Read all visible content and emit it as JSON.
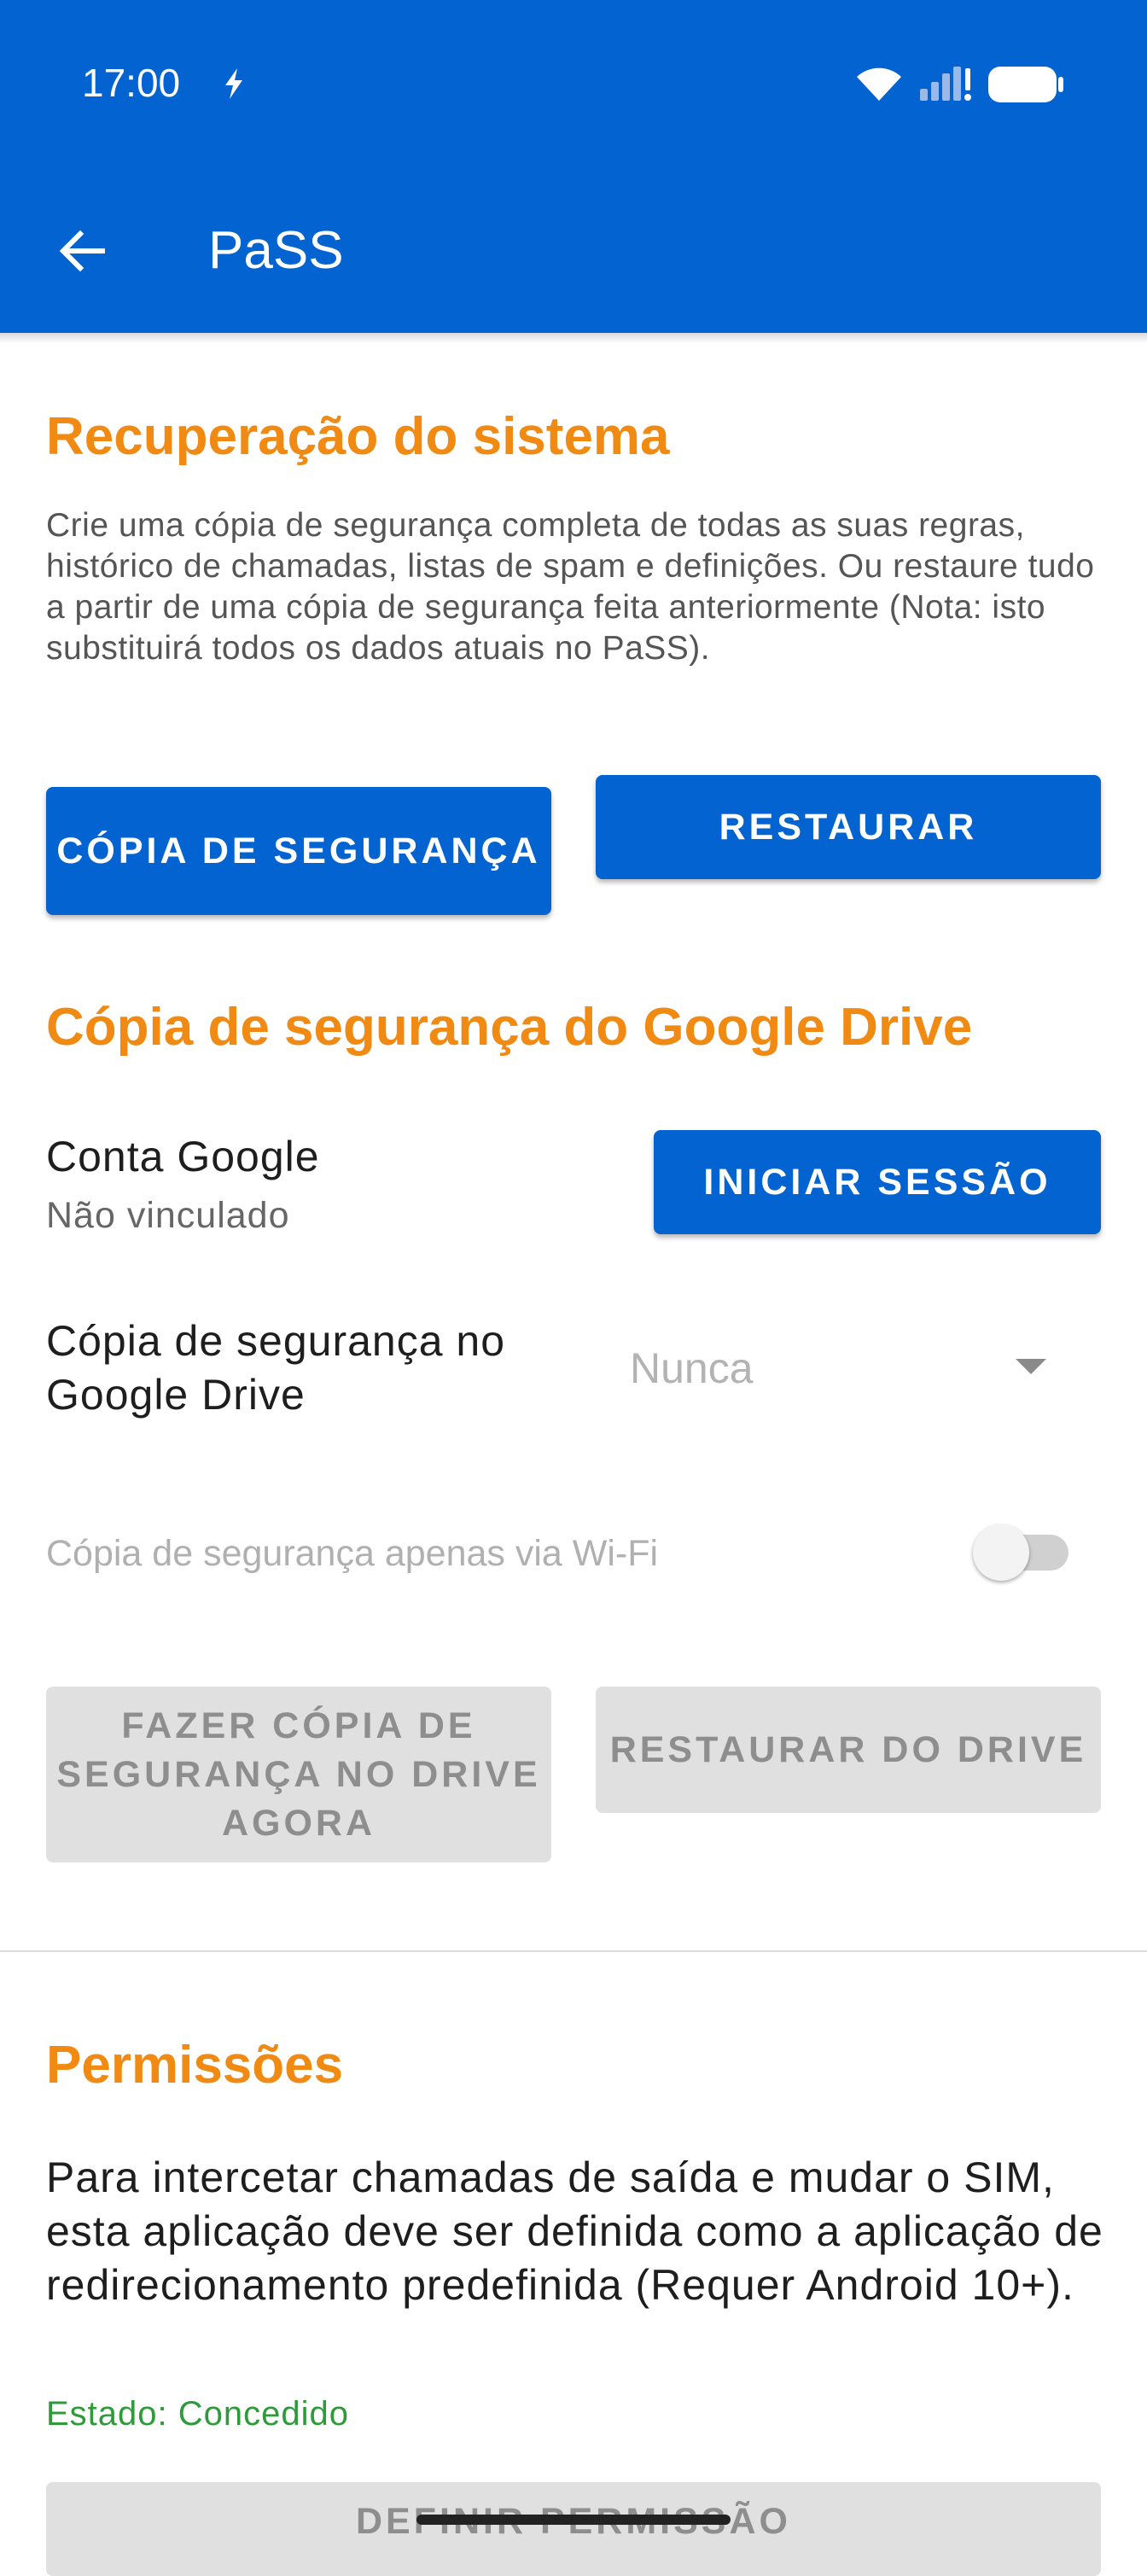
{
  "status_bar": {
    "time": "17:00",
    "icons": [
      "bolt-icon",
      "wifi-icon",
      "cell-signal-icon",
      "battery-icon"
    ]
  },
  "app_bar": {
    "title": "PaSS",
    "back_icon": "arrow-left-icon",
    "color": "#0263d1"
  },
  "system_recovery": {
    "title": "Recuperação do sistema",
    "description": "Crie uma cópia de segurança completa de todas as suas regras, histórico de chamadas, listas de spam e definições. Ou restaure tudo a partir de uma cópia de segurança feita anteriormente (Nota: isto substituirá todos os dados atuais no PaSS).",
    "backup_label": "CÓPIA DE SEGURANÇA",
    "restore_label": "RESTAURAR"
  },
  "google_drive": {
    "title": "Cópia de segurança do Google Drive",
    "account_label": "Conta Google",
    "account_status": "Não vinculado",
    "sign_in_label": "INICIAR SESSÃO",
    "backup_freq_label": "Cópia de segurança no Google Drive",
    "backup_freq_value": "Nunca",
    "wifi_only_label": "Cópia de segurança apenas via Wi-Fi",
    "wifi_only_enabled": false,
    "backup_now_label": "FAZER CÓPIA DE SEGURANÇA NO DRIVE AGORA",
    "restore_drive_label": "RESTAURAR DO DRIVE"
  },
  "permissions": {
    "title": "Permissões",
    "text": "Para intercetar chamadas de saída e mudar o SIM, esta aplicação deve ser definida como a aplicação de redirecionamento predefinida (Requer Android 10+).",
    "status": "Estado: Concedido",
    "set_permission_label": "DEFINIR PERMISSÃO"
  },
  "colors": {
    "accent": "#f08a13",
    "primary": "#0263d1",
    "status_ok": "#2e9a3a"
  }
}
